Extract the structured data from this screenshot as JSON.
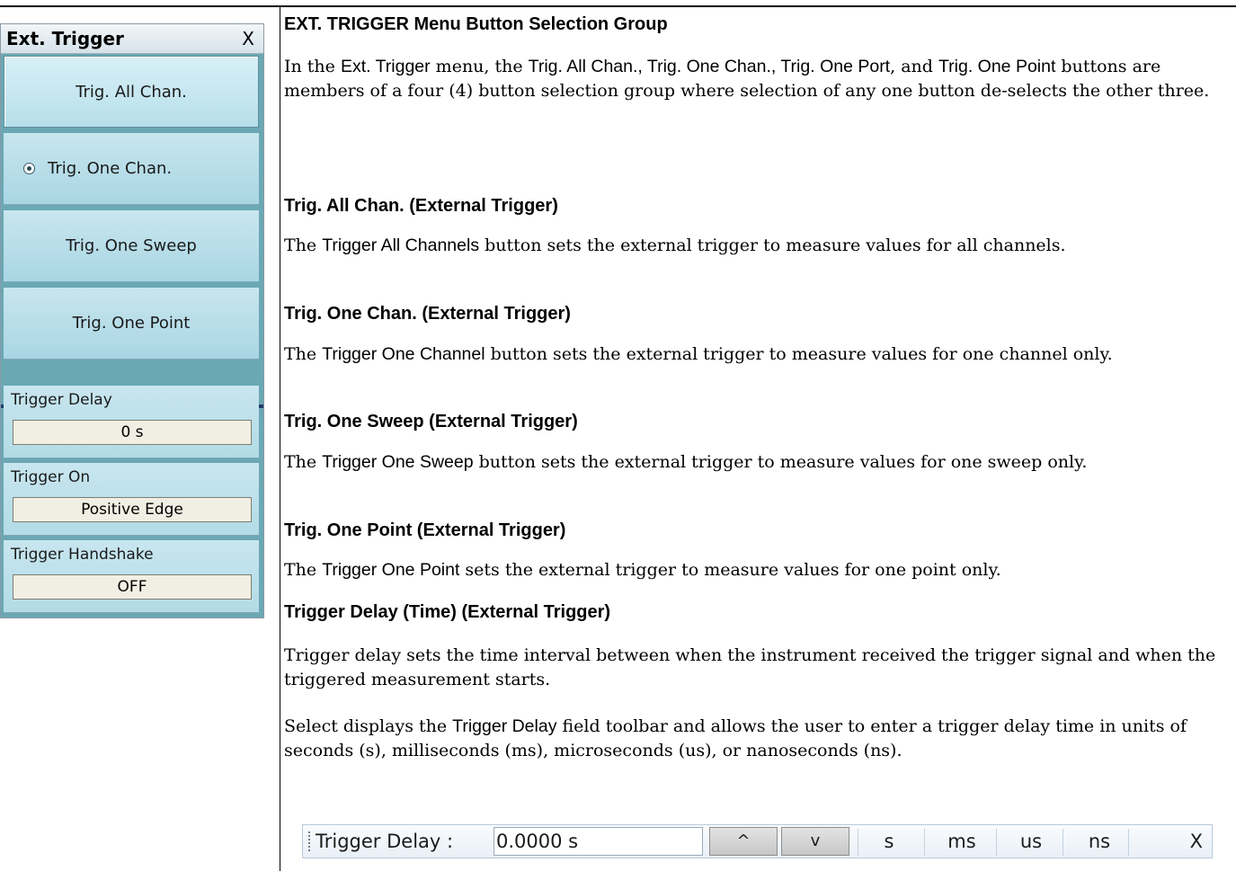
{
  "menu": {
    "title": "Ext. Trigger",
    "close": "X",
    "buttons": [
      {
        "label": "Trig. All Chan."
      },
      {
        "label": "Trig. One Chan."
      },
      {
        "label": "Trig. One Sweep"
      },
      {
        "label": "Trig. One Point"
      }
    ],
    "fields": [
      {
        "label": "Trigger Delay",
        "value": "0 s"
      },
      {
        "label": "Trigger On",
        "value": "Positive Edge"
      },
      {
        "label": "Trigger Handshake",
        "value": "OFF"
      }
    ]
  },
  "doc": {
    "group_heading": "EXT. TRIGGER Menu Button Selection Group",
    "group_p": {
      "t1": "In the ",
      "ui1": "Ext. Trigger",
      "t2": " menu, the ",
      "ui2": "Trig. All Chan., Trig. One Chan., Trig. One Port",
      "t3": ", and ",
      "ui3": "Trig. One Point",
      "t4": " buttons are members of a four (4) button selection group where selection of any one button de-selects the other three."
    },
    "all_heading": "Trig. All Chan. (External Trigger)",
    "all_p": {
      "t1": "The ",
      "ui": "Trigger All Channels",
      "t2": " button sets the external trigger to measure values for all channels."
    },
    "one_chan_heading": "Trig. One Chan. (External Trigger)",
    "one_chan_p": {
      "t1": "The ",
      "ui": "Trigger One Channel",
      "t2": " button sets the external trigger to measure values for one channel only."
    },
    "sweep_heading": "Trig. One Sweep (External Trigger)",
    "sweep_p": {
      "t1": "The ",
      "ui": "Trigger One Sweep",
      "t2": " button sets the external trigger to measure values for one sweep only."
    },
    "point_heading": "Trig. One Point (External Trigger)",
    "point_p": {
      "t1": "The ",
      "ui": "Trigger One Point",
      "t2": " sets the external trigger to measure values for one point only."
    },
    "delay_heading": "Trigger Delay (Time) (External Trigger)",
    "delay_p1": "Trigger delay sets the time interval between when the instrument received the trigger signal and when the triggered measurement starts.",
    "delay_p2": {
      "t1": "Select displays the ",
      "ui": "Trigger Delay",
      "t2": " field toolbar and allows the user to enter a trigger delay time in units of seconds (s), milliseconds (ms), microseconds (us), or nanoseconds (ns)."
    }
  },
  "toolbar": {
    "label": "Trigger Delay  :",
    "value": "0.0000  s",
    "up": "^",
    "down": "v",
    "units": [
      "s",
      "ms",
      "us",
      "ns"
    ],
    "close": "X"
  }
}
